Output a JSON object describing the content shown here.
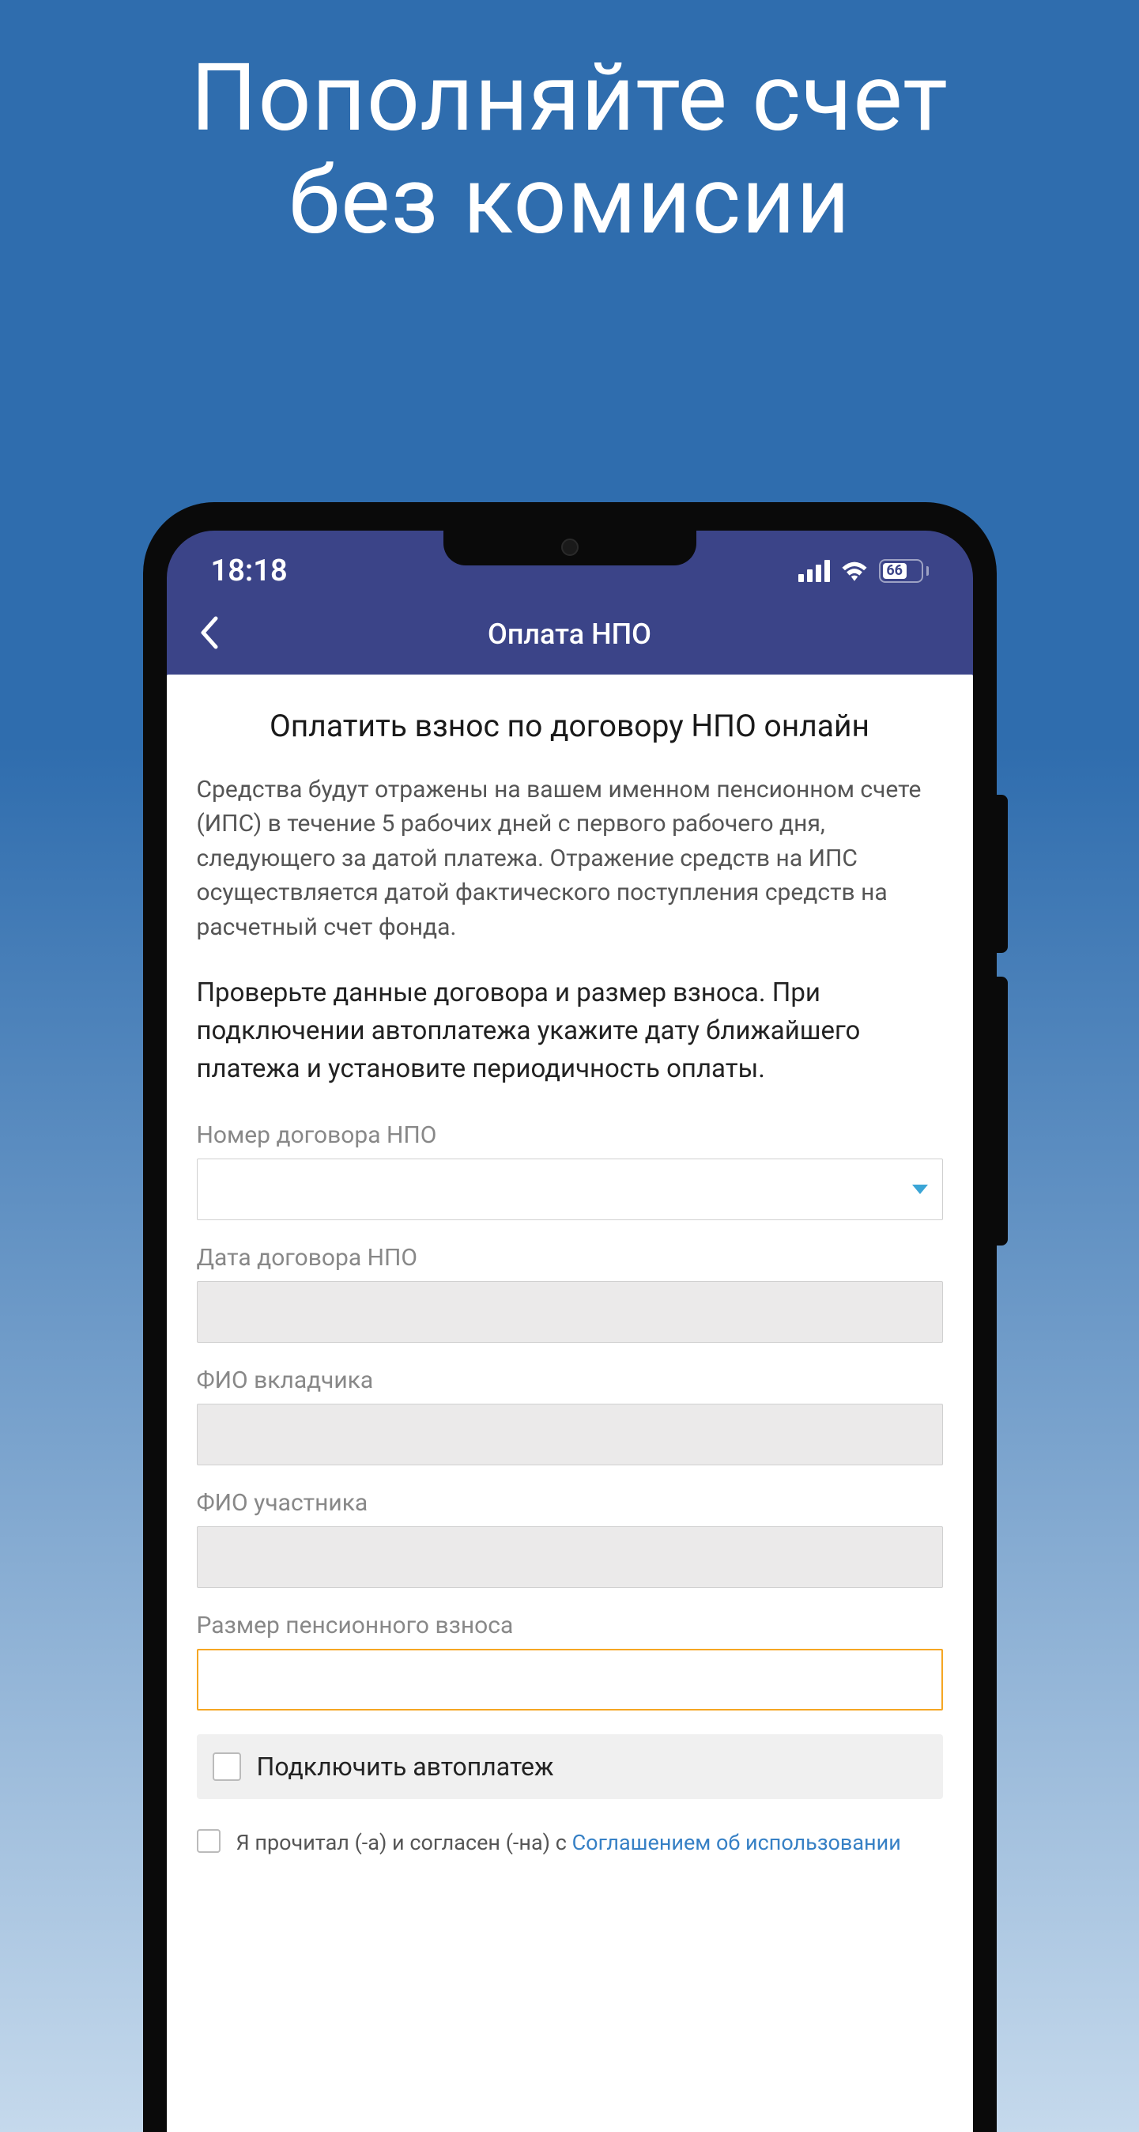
{
  "headline_line1": "Пополняйте счет",
  "headline_line2": "без комисии",
  "status": {
    "time": "18:18",
    "battery": "66"
  },
  "nav": {
    "title": "Оплата НПО"
  },
  "content": {
    "title": "Оплатить взнос по договору НПО онлайн",
    "description": "Средства будут отражены на вашем именном пенсионном счете (ИПС) в течение 5 рабочих дней с первого рабочего дня, следующего за датой платежа. Отражение средств на ИПС осуществляется датой фактического поступления средств на расчетный счет фонда.",
    "instruction": "Проверьте данные договора и размер взноса. При подключении автоплатежа укажите дату ближайшего платежа и установите периодичность оплаты."
  },
  "form": {
    "contract_number_label": "Номер договора НПО",
    "contract_date_label": "Дата договора НПО",
    "depositor_name_label": "ФИО вкладчика",
    "participant_name_label": "ФИО участника",
    "contribution_amount_label": "Размер пенсионного взноса",
    "autopay_label": "Подключить автоплатеж",
    "agreement_text": "Я прочитал (-а) и согласен (-на) с ",
    "agreement_link": "Соглашением об использовании"
  }
}
